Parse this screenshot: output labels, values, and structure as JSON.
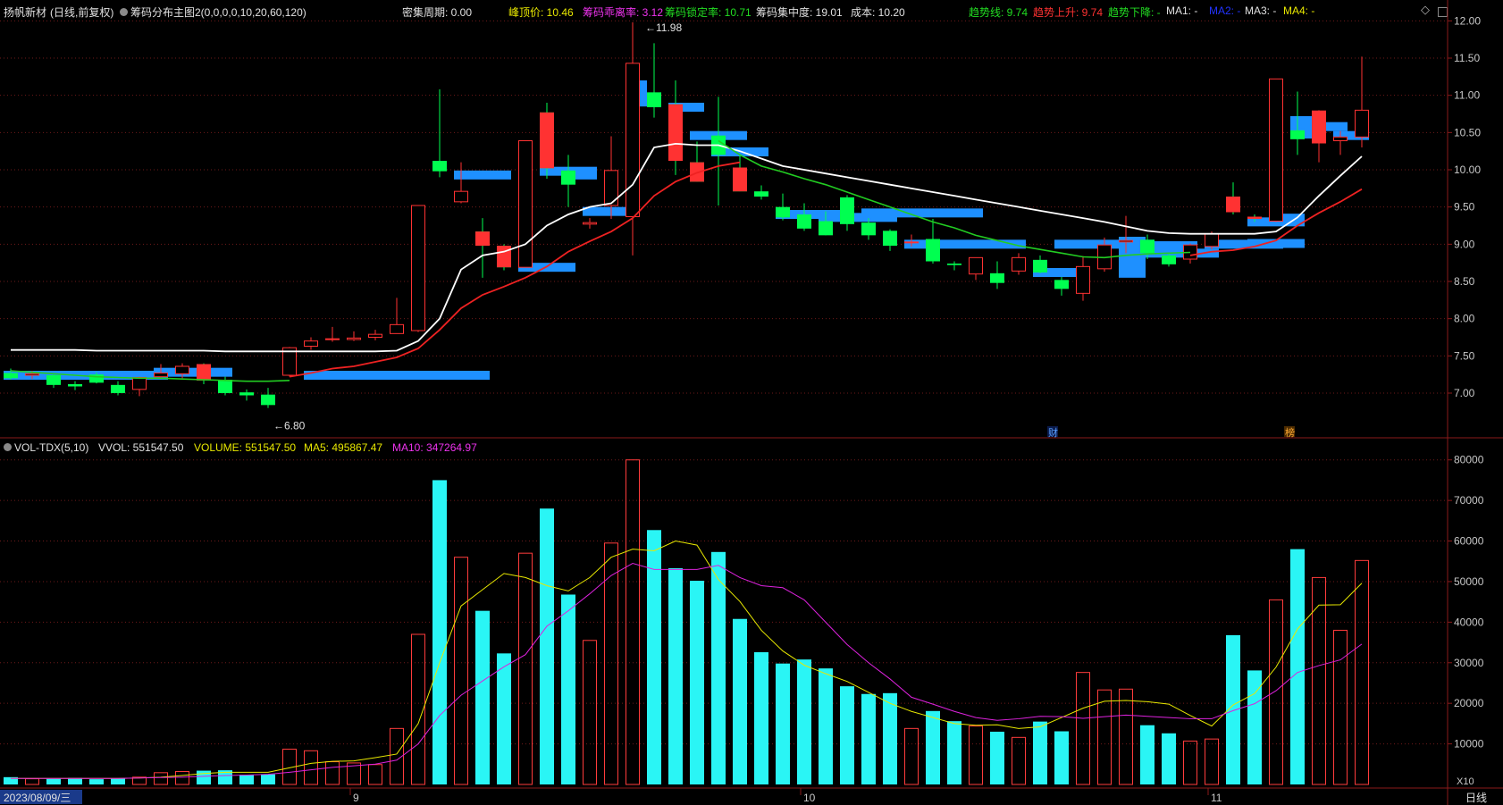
{
  "colors": {
    "background": "#000000",
    "grid": "#6e1a1a",
    "rise": "#ff3232",
    "fall": "#00ff50",
    "chip_blue": "#1e90ff",
    "vol_cyan": "#2af5f5",
    "vol_red": "#ff3c3c",
    "ma_white": "#ffffff",
    "ma_red": "#ee2222",
    "ma_green": "#22cc22",
    "ma5_yellow": "#e8e800",
    "ma10_magenta": "#dd22dd"
  },
  "header": {
    "stock_name": "扬帆新材",
    "period": "(日线,前复权)",
    "indicator": "筹码分布主图2(0,0,0,0,10,20,60,120)",
    "density_label": "密集周期: 0.00",
    "peak_label": "峰顶价: 10.46",
    "loose_label": "筹码乖离率: 3.12",
    "lock_label": "筹码锁定率: 10.71",
    "concentration_label": "筹码集中度: 19.01",
    "cost_label": "成本: 10.20",
    "trend_label": "趋势线: 9.74",
    "trend_up_label": "趋势上升: 9.74",
    "trend_down_label": "趋势下降: -",
    "ma1_label": "MA1: -",
    "ma2_label": "MA2: -",
    "ma3_label": "MA3: -",
    "ma4_label": "MA4: -"
  },
  "vol_header": {
    "indicator": "VOL-TDX(5,10)",
    "vvol_label": "VVOL: 551547.50",
    "volume_label": "VOLUME: 551547.50",
    "ma5_label": "MA5: 495867.47",
    "ma10_label": "MA10: 347264.97"
  },
  "price_axis": [
    "12.00",
    "11.50",
    "11.00",
    "10.50",
    "10.00",
    "9.50",
    "9.00",
    "8.50",
    "8.00",
    "7.50",
    "7.00"
  ],
  "vol_axis": [
    "80000",
    "70000",
    "60000",
    "50000",
    "40000",
    "30000",
    "20000",
    "10000"
  ],
  "vol_axis_unit": "X10",
  "bottom_axis": {
    "start_date": "2023/08/09/三",
    "months": [
      "9",
      "10",
      "11"
    ],
    "period_button": "日线"
  },
  "markers": {
    "high_label": "11.98",
    "low_label": "6.80",
    "event_cai": "财",
    "event_bang": "榜"
  },
  "chart_data": {
    "type": "candlestick",
    "candles": [
      {
        "o": 7.27,
        "h": 7.33,
        "l": 7.18,
        "c": 7.2
      },
      {
        "o": 7.24,
        "h": 7.3,
        "l": 7.19,
        "c": 7.26
      },
      {
        "o": 7.24,
        "h": 7.27,
        "l": 7.07,
        "c": 7.11
      },
      {
        "o": 7.12,
        "h": 7.16,
        "l": 7.04,
        "c": 7.09
      },
      {
        "o": 7.25,
        "h": 7.28,
        "l": 7.13,
        "c": 7.14
      },
      {
        "o": 7.11,
        "h": 7.16,
        "l": 6.97,
        "c": 7.0
      },
      {
        "o": 7.05,
        "h": 7.22,
        "l": 6.96,
        "c": 7.21
      },
      {
        "o": 7.22,
        "h": 7.39,
        "l": 7.2,
        "c": 7.27
      },
      {
        "o": 7.26,
        "h": 7.4,
        "l": 7.2,
        "c": 7.36
      },
      {
        "o": 7.39,
        "h": 7.4,
        "l": 7.12,
        "c": 7.17
      },
      {
        "o": 7.18,
        "h": 7.22,
        "l": 6.97,
        "c": 7.0
      },
      {
        "o": 7.01,
        "h": 7.05,
        "l": 6.9,
        "c": 6.97
      },
      {
        "o": 6.98,
        "h": 7.07,
        "l": 6.8,
        "c": 6.84
      },
      {
        "o": 7.24,
        "h": 7.62,
        "l": 7.22,
        "c": 7.61
      },
      {
        "o": 7.63,
        "h": 7.75,
        "l": 7.58,
        "c": 7.7
      },
      {
        "o": 7.72,
        "h": 7.89,
        "l": 7.69,
        "c": 7.73
      },
      {
        "o": 7.72,
        "h": 7.83,
        "l": 7.7,
        "c": 7.74
      },
      {
        "o": 7.75,
        "h": 7.85,
        "l": 7.71,
        "c": 7.79
      },
      {
        "o": 7.8,
        "h": 8.28,
        "l": 7.8,
        "c": 7.92
      },
      {
        "o": 7.84,
        "h": 9.52,
        "l": 7.82,
        "c": 9.52
      },
      {
        "o": 10.12,
        "h": 11.08,
        "l": 9.9,
        "c": 9.98
      },
      {
        "o": 9.57,
        "h": 10.1,
        "l": 9.55,
        "c": 9.71
      },
      {
        "o": 9.17,
        "h": 9.35,
        "l": 8.55,
        "c": 8.98
      },
      {
        "o": 8.98,
        "h": 9.0,
        "l": 8.65,
        "c": 8.69
      },
      {
        "o": 8.69,
        "h": 10.39,
        "l": 8.69,
        "c": 10.39
      },
      {
        "o": 10.77,
        "h": 10.9,
        "l": 9.88,
        "c": 10.02
      },
      {
        "o": 9.99,
        "h": 10.2,
        "l": 9.5,
        "c": 9.8
      },
      {
        "o": 9.27,
        "h": 9.35,
        "l": 9.21,
        "c": 9.29
      },
      {
        "o": 9.52,
        "h": 10.45,
        "l": 9.34,
        "c": 9.99
      },
      {
        "o": 9.37,
        "h": 11.98,
        "l": 8.85,
        "c": 11.43
      },
      {
        "o": 11.04,
        "h": 11.7,
        "l": 10.7,
        "c": 10.84
      },
      {
        "o": 10.88,
        "h": 11.2,
        "l": 9.93,
        "c": 10.12
      },
      {
        "o": 10.1,
        "h": 10.38,
        "l": 9.84,
        "c": 9.84
      },
      {
        "o": 10.46,
        "h": 10.98,
        "l": 9.52,
        "c": 10.2
      },
      {
        "o": 10.03,
        "h": 10.2,
        "l": 9.71,
        "c": 9.71
      },
      {
        "o": 9.71,
        "h": 9.79,
        "l": 9.6,
        "c": 9.64
      },
      {
        "o": 9.5,
        "h": 9.68,
        "l": 9.32,
        "c": 9.36
      },
      {
        "o": 9.4,
        "h": 9.55,
        "l": 9.18,
        "c": 9.21
      },
      {
        "o": 9.31,
        "h": 9.44,
        "l": 9.12,
        "c": 9.12
      },
      {
        "o": 9.63,
        "h": 9.66,
        "l": 9.18,
        "c": 9.27
      },
      {
        "o": 9.29,
        "h": 9.35,
        "l": 9.06,
        "c": 9.12
      },
      {
        "o": 9.18,
        "h": 9.2,
        "l": 8.91,
        "c": 8.98
      },
      {
        "o": 9.02,
        "h": 9.13,
        "l": 8.97,
        "c": 9.03
      },
      {
        "o": 9.07,
        "h": 9.34,
        "l": 8.74,
        "c": 8.77
      },
      {
        "o": 8.74,
        "h": 8.77,
        "l": 8.65,
        "c": 8.72
      },
      {
        "o": 8.6,
        "h": 8.82,
        "l": 8.52,
        "c": 8.82
      },
      {
        "o": 8.61,
        "h": 8.77,
        "l": 8.4,
        "c": 8.48
      },
      {
        "o": 8.64,
        "h": 8.88,
        "l": 8.59,
        "c": 8.82
      },
      {
        "o": 8.79,
        "h": 8.85,
        "l": 8.61,
        "c": 8.62
      },
      {
        "o": 8.52,
        "h": 8.56,
        "l": 8.31,
        "c": 8.4
      },
      {
        "o": 8.34,
        "h": 8.84,
        "l": 8.24,
        "c": 8.7
      },
      {
        "o": 8.67,
        "h": 9.09,
        "l": 8.63,
        "c": 8.99
      },
      {
        "o": 9.03,
        "h": 9.38,
        "l": 8.88,
        "c": 9.05
      },
      {
        "o": 9.06,
        "h": 9.13,
        "l": 8.8,
        "c": 8.88
      },
      {
        "o": 8.85,
        "h": 8.89,
        "l": 8.7,
        "c": 8.73
      },
      {
        "o": 8.8,
        "h": 9.01,
        "l": 8.74,
        "c": 8.99
      },
      {
        "o": 8.97,
        "h": 9.17,
        "l": 8.93,
        "c": 9.14
      },
      {
        "o": 9.64,
        "h": 9.83,
        "l": 9.4,
        "c": 9.43
      },
      {
        "o": 9.37,
        "h": 9.4,
        "l": 9.3,
        "c": 9.34
      },
      {
        "o": 9.31,
        "h": 11.22,
        "l": 9.3,
        "c": 11.22
      },
      {
        "o": 10.53,
        "h": 11.05,
        "l": 10.2,
        "c": 10.41
      },
      {
        "o": 10.36,
        "h": 10.8,
        "l": 10.1,
        "c": 10.79
      },
      {
        "o": 10.39,
        "h": 10.52,
        "l": 10.2,
        "c": 10.44
      },
      {
        "o": 10.44,
        "h": 11.52,
        "l": 10.3,
        "c": 10.8
      }
    ],
    "ma_white": [
      7.58,
      7.58,
      7.58,
      7.58,
      7.57,
      7.57,
      7.57,
      7.57,
      7.57,
      7.57,
      7.56,
      7.56,
      7.56,
      7.56,
      7.56,
      7.56,
      7.56,
      7.56,
      7.57,
      7.7,
      8.0,
      8.66,
      8.85,
      8.9,
      9.0,
      9.25,
      9.4,
      9.5,
      9.55,
      9.8,
      10.3,
      10.35,
      10.33,
      10.33,
      10.25,
      10.15,
      10.05,
      10.0,
      9.95,
      9.9,
      9.85,
      9.8,
      9.75,
      9.7,
      9.65,
      9.6,
      9.55,
      9.5,
      9.45,
      9.4,
      9.35,
      9.3,
      9.24,
      9.18,
      9.15,
      9.14,
      9.14,
      9.14,
      9.14,
      9.17,
      9.36,
      9.65,
      9.92,
      10.18
    ],
    "ma_red": [
      null,
      null,
      null,
      null,
      null,
      null,
      null,
      null,
      null,
      null,
      null,
      null,
      null,
      7.22,
      7.27,
      7.33,
      7.36,
      7.42,
      7.48,
      7.6,
      7.85,
      8.14,
      8.32,
      8.43,
      8.55,
      8.7,
      8.9,
      9.04,
      9.17,
      9.35,
      9.65,
      9.84,
      9.96,
      10.05,
      10.1,
      null,
      null,
      null,
      null,
      null,
      null,
      null,
      null,
      null,
      null,
      null,
      null,
      null,
      null,
      null,
      null,
      null,
      null,
      null,
      null,
      8.85,
      8.9,
      8.92,
      8.97,
      9.05,
      9.25,
      9.42,
      9.57,
      9.74
    ],
    "ma_green": [
      7.3,
      7.28,
      7.26,
      7.24,
      7.22,
      7.21,
      7.2,
      7.2,
      7.19,
      7.18,
      7.17,
      7.16,
      7.16,
      7.17,
      null,
      null,
      null,
      null,
      null,
      null,
      null,
      null,
      null,
      null,
      null,
      null,
      null,
      null,
      null,
      null,
      null,
      null,
      null,
      10.39,
      10.2,
      10.05,
      9.97,
      9.88,
      9.8,
      9.7,
      9.6,
      9.5,
      9.4,
      9.3,
      9.22,
      9.12,
      9.05,
      8.98,
      8.93,
      8.88,
      8.83,
      8.82,
      8.85,
      8.87,
      8.88,
      8.89,
      null,
      null,
      null,
      null,
      null,
      null,
      null,
      null
    ],
    "volume": [
      1800,
      1400,
      1400,
      1600,
      1300,
      1500,
      1800,
      2900,
      3200,
      3400,
      3500,
      2400,
      2500,
      8700,
      8300,
      5600,
      5300,
      4900,
      13800,
      37000,
      75000,
      56000,
      42800,
      32300,
      57000,
      68000,
      46800,
      35500,
      59500,
      80000,
      62700,
      53300,
      50200,
      57300,
      40800,
      32600,
      29800,
      30800,
      28600,
      24200,
      22300,
      22500,
      13800,
      18100,
      15600,
      14400,
      13000,
      11600,
      15500,
      13100,
      27600,
      23300,
      23500,
      14600,
      12600,
      10700,
      11200,
      36800,
      28100,
      45500,
      58000,
      51000,
      38000,
      55200
    ],
    "ma5": [
      1500,
      1500,
      1500,
      1500,
      1500,
      1500,
      1600,
      1800,
      2200,
      2700,
      3000,
      3000,
      3000,
      4100,
      5200,
      5700,
      5800,
      6600,
      7500,
      15000,
      30000,
      44000,
      48000,
      52000,
      51000,
      49000,
      47700,
      51000,
      56000,
      58000,
      57600,
      60000,
      59000,
      50500,
      45100,
      38000,
      32900,
      29400,
      27300,
      25400,
      22700,
      20000,
      18000,
      16500,
      15000,
      14600,
      14700,
      13800,
      14200,
      16500,
      18800,
      20500,
      20700,
      20400,
      19800,
      17000,
      14400,
      19600,
      22400,
      28900,
      38300,
      44200,
      44300,
      49600
    ],
    "ma10": [
      1500,
      1500,
      1500,
      1500,
      1500,
      1500,
      1600,
      1700,
      1800,
      2000,
      2200,
      2300,
      2500,
      3000,
      3600,
      4200,
      4600,
      5000,
      6000,
      10000,
      17000,
      22000,
      25500,
      29000,
      32000,
      39000,
      42800,
      47000,
      51500,
      54500,
      53000,
      53000,
      53000,
      54000,
      51000,
      49000,
      48500,
      45500,
      40000,
      34500,
      30000,
      26000,
      21500,
      19800,
      18000,
      16500,
      15800,
      16200,
      16800,
      16700,
      16300,
      16700,
      17100,
      16800,
      16500,
      16200,
      16200,
      18200,
      19900,
      23100,
      27600,
      29300,
      30700,
      34600
    ]
  }
}
